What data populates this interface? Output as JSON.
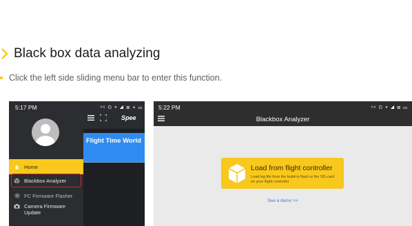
{
  "section": {
    "title": "Black box data analyzing",
    "subtitle": "Click the left side sliding menu bar to enter this function."
  },
  "colors": {
    "accent": "#f8c81c",
    "highlight": "#d9232a",
    "blue": "#2f8bf0"
  },
  "phone_menu": {
    "status_time": "5:17 PM",
    "status_icons": "⁴⁶ ⏲ ▾ ◢ ⊠ + ▭",
    "items": [
      {
        "label": "Home",
        "icon": "home-icon"
      },
      {
        "label": "Blackbox Analyzer",
        "icon": "cube-icon"
      },
      {
        "label": "FC Firmware Flasher",
        "icon": "chip-icon"
      },
      {
        "label": "Camera Firmware Update",
        "icon": "camera-icon"
      }
    ],
    "brand": "Spee",
    "banner_text": "Flight Time World"
  },
  "phone_analyzer": {
    "status_time": "5:22 PM",
    "status_icons": "⁴⁶ ⏲ ▾ ◢ ⊠ ▭",
    "title": "Blackbox Analyzer",
    "card": {
      "title": "Load from flight controller",
      "description": "Load log file from the build-in flash or the SD-card on your flight controller"
    },
    "demo_link": "See a demo >>"
  }
}
